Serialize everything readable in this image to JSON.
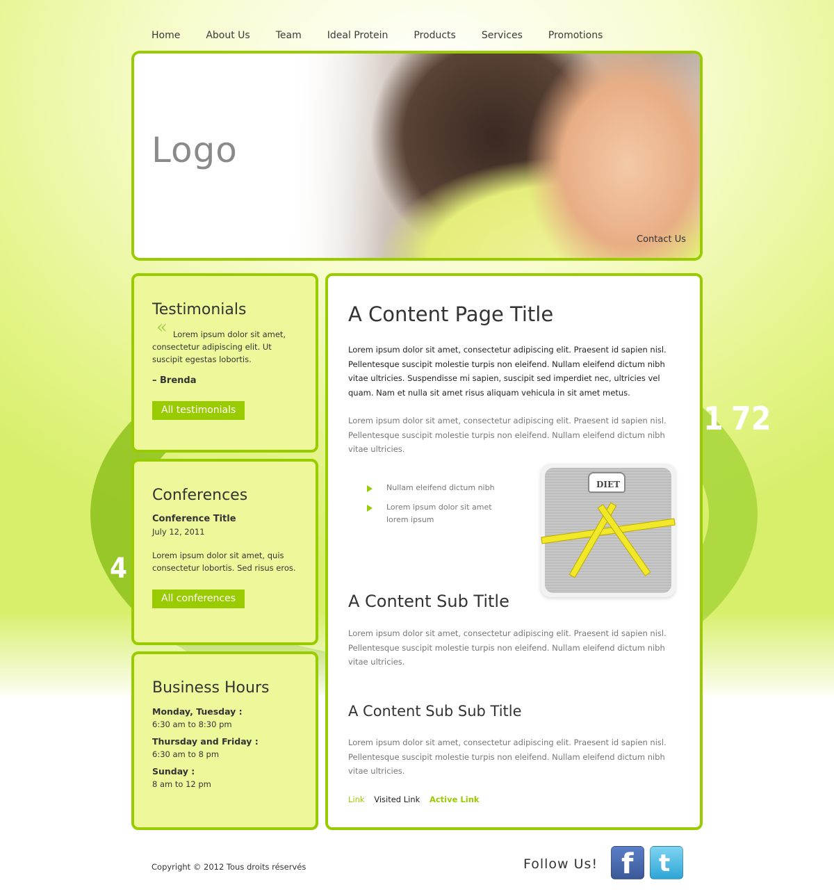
{
  "nav": {
    "items": [
      "Home",
      "About Us",
      "Team",
      "Ideal Protein",
      "Products",
      "Services",
      "Promotions"
    ]
  },
  "header": {
    "logo": "Logo",
    "contact_link": "Contact Us"
  },
  "background": {
    "tape_numbers": [
      "72",
      "1",
      "4"
    ]
  },
  "testimonials": {
    "title": "Testimonials",
    "quote_mark": "«",
    "quote": "Lorem ipsum dolor sit amet, consectetur adipiscing elit. Ut suscipit egestas lobortis.",
    "author": "– Brenda",
    "button": "All testimonials"
  },
  "conferences": {
    "title": "Conferences",
    "conference_title": "Conference Title",
    "date": "July 12, 2011",
    "text": "Lorem ipsum dolor sit amet, quis consectetur lobortis. Sed risus eros.",
    "button": "All conferences"
  },
  "hours": {
    "title": "Business Hours",
    "entries": [
      {
        "day": "Monday, Tuesday :",
        "time": "6:30 am to 8:30 pm"
      },
      {
        "day": "Thursday and Friday :",
        "time": "6:30 am to 8 pm"
      },
      {
        "day": "Sunday :",
        "time": "8 am to 12 pm"
      }
    ]
  },
  "main": {
    "title": "A Content Page Title",
    "intro": "Lorem ipsum dolor sit amet, consectetur adipiscing elit. Praesent id sapien nisl. Pellentesque suscipit molestie turpis non eleifend. Nullam eleifend dictum nibh vitae ultricies. Suspendisse mi sapien, suscipit sed imperdiet nec, ultricies vel quam. Nam et nulla sit amet risus aliquam vehicula in sit amet metus.",
    "para1": "Lorem ipsum dolor sit amet, consectetur adipiscing elit. Praesent id sapien nisl. Pellentesque suscipit molestie turpis non eleifend. Nullam eleifend dictum nibh vitae ultricies.",
    "bullets": [
      "Nullam eleifend dictum nibh",
      "Lorem ipsum dolor sit amet lorem ipsum"
    ],
    "scale_label": "DIET",
    "subtitle": "A Content Sub Title",
    "para2": "Lorem ipsum dolor sit amet, consectetur adipiscing elit. Praesent id sapien nisl. Pellentesque suscipit molestie turpis non eleifend. Nullam eleifend dictum nibh vitae ultricies.",
    "subsubtitle": "A Content Sub Sub Title",
    "para3": "Lorem ipsum dolor sit amet, consectetur adipiscing elit. Praesent id sapien nisl. Pellentesque suscipit molestie turpis non eleifend. Nullam eleifend dictum nibh vitae ultricies.",
    "links": {
      "link": "Link",
      "visited": "Visited Link",
      "active": "Active Link"
    }
  },
  "footer": {
    "copyright": "Copyright © 2012 Tous droits réservés",
    "follow": "Follow Us!",
    "facebook_glyph": "f",
    "twitter_glyph": "t"
  },
  "colors": {
    "accent": "#99cc00",
    "sidebar_bg": "#eef89a",
    "text": "#333333",
    "muted_text": "#777777"
  }
}
